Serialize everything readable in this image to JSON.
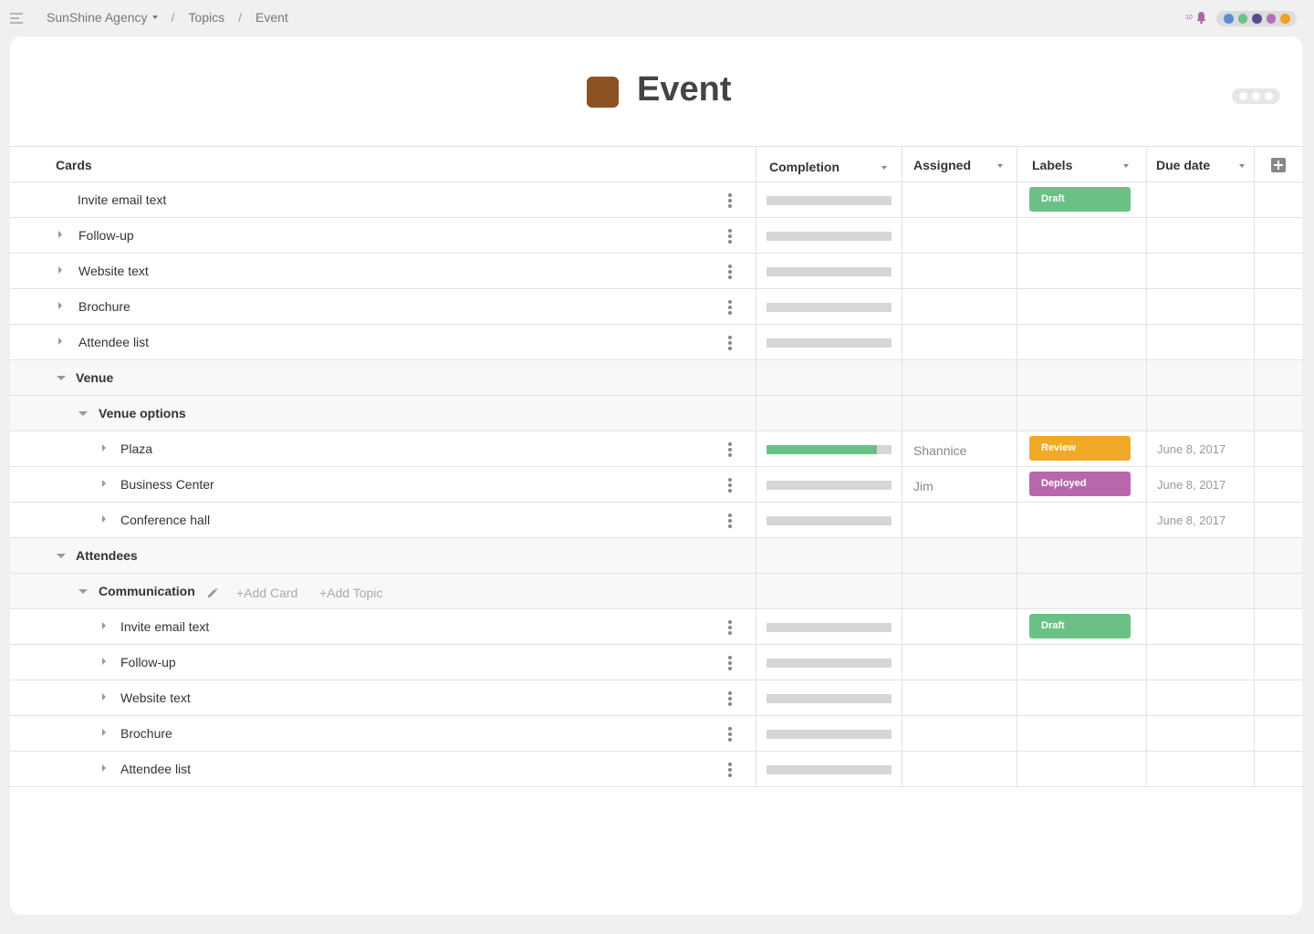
{
  "breadcrumb": {
    "workspace": "SunShine Agency",
    "section": "Topics",
    "page": "Event",
    "separator": "/"
  },
  "notifications": {
    "count": "10",
    "icon": "bell-icon",
    "color": "#a86ba8"
  },
  "members": {
    "colors": [
      "#5b8dd6",
      "#6cc287",
      "#5a4a8f",
      "#b86bb8",
      "#f0a020"
    ]
  },
  "page": {
    "title": "Event",
    "swatch_color": "#8b5222"
  },
  "columns": {
    "cards": "Cards",
    "completion": "Completion",
    "assigned": "Assigned",
    "labels": "Labels",
    "due_date": "Due date"
  },
  "label_colors": {
    "Draft": "#6bc185",
    "Review": "#f0aa28",
    "Deployed": "#b867ad"
  },
  "progress_fill_color": "#6bc185",
  "communication_actions": {
    "add_card": "+Add Card",
    "add_topic": "+Add Topic"
  },
  "rows": [
    {
      "type": "card",
      "name": "Invite email text",
      "expandable": false,
      "completion": 0,
      "assigned": "",
      "label": "Draft",
      "due": ""
    },
    {
      "type": "card",
      "name": "Follow-up",
      "expandable": true,
      "completion": 0,
      "assigned": "",
      "label": "",
      "due": ""
    },
    {
      "type": "card",
      "name": "Website text",
      "expandable": true,
      "completion": 0,
      "assigned": "",
      "label": "",
      "due": ""
    },
    {
      "type": "card",
      "name": "Brochure",
      "expandable": true,
      "completion": 0,
      "assigned": "",
      "label": "",
      "due": ""
    },
    {
      "type": "card",
      "name": "Attendee list",
      "expandable": true,
      "completion": 0,
      "assigned": "",
      "label": "",
      "due": ""
    },
    {
      "type": "group",
      "name": "Venue"
    },
    {
      "type": "subgroup",
      "name": "Venue options"
    },
    {
      "type": "card",
      "name": "Plaza",
      "expandable": true,
      "completion": 0.88,
      "assigned": "Shannice",
      "label": "Review",
      "due": "June 8, 2017"
    },
    {
      "type": "card",
      "name": "Business Center",
      "expandable": true,
      "completion": 0,
      "assigned": "Jim",
      "label": "Deployed",
      "due": "June 8, 2017"
    },
    {
      "type": "card",
      "name": "Conference hall",
      "expandable": true,
      "completion": 0,
      "assigned": "",
      "label": "",
      "due": "June 8, 2017"
    },
    {
      "type": "group",
      "name": "Attendees"
    },
    {
      "type": "subgroup",
      "name": "Communication",
      "actions": true
    },
    {
      "type": "card",
      "name": "Invite email text",
      "expandable": true,
      "completion": 0,
      "assigned": "",
      "label": "Draft",
      "due": ""
    },
    {
      "type": "card",
      "name": "Follow-up",
      "expandable": true,
      "completion": 0,
      "assigned": "",
      "label": "",
      "due": ""
    },
    {
      "type": "card",
      "name": "Website text",
      "expandable": true,
      "completion": 0,
      "assigned": "",
      "label": "",
      "due": ""
    },
    {
      "type": "card",
      "name": "Brochure",
      "expandable": true,
      "completion": 0,
      "assigned": "",
      "label": "",
      "due": ""
    },
    {
      "type": "card",
      "name": "Attendee list",
      "expandable": true,
      "completion": 0,
      "assigned": "",
      "label": "",
      "due": ""
    }
  ]
}
